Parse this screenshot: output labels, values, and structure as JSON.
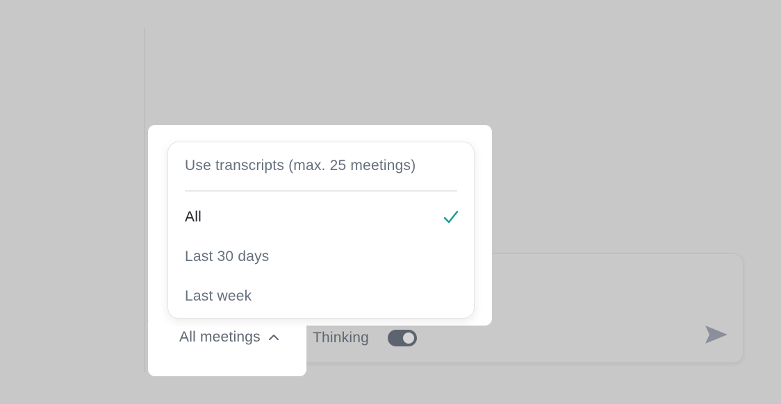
{
  "composer": {
    "thinking_label": "Thinking",
    "thinking_enabled": true,
    "send_icon": "send-icon"
  },
  "meetings_dropdown": {
    "trigger_label": "All meetings",
    "trigger_icon": "chevron-up-icon",
    "header": "Use transcripts (max. 25 meetings)",
    "options": [
      {
        "label": "All",
        "selected": true
      },
      {
        "label": "Last 30 days",
        "selected": false
      },
      {
        "label": "Last week",
        "selected": false
      }
    ],
    "check_icon": "check-icon"
  },
  "colors": {
    "overlay": "#c8c8c8",
    "accent_check": "#1a9a8e",
    "muted_text": "#66707e",
    "primary_text": "#1f2329",
    "toggle_track": "#5c6470"
  }
}
